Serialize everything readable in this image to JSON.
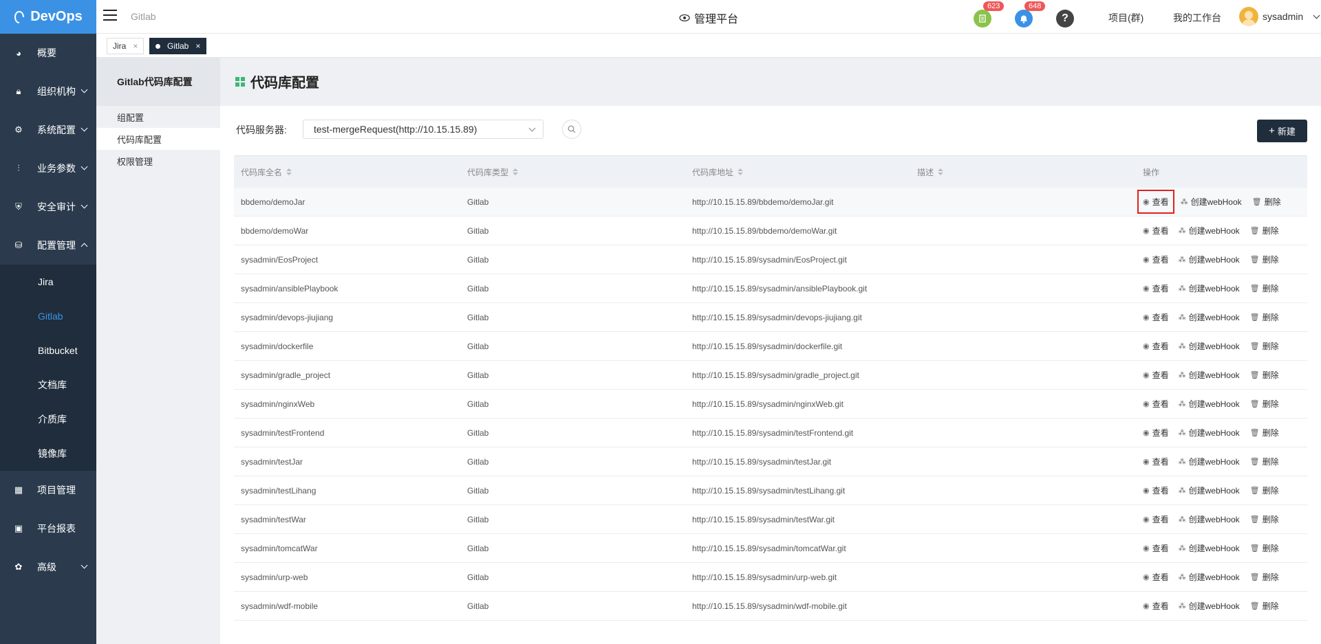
{
  "app": {
    "logo": "DevOps",
    "crumb": "Gitlab",
    "platform_title": "管理平台"
  },
  "header": {
    "badge_doc": "623",
    "badge_bell": "648",
    "link_projects": "项目(群)",
    "link_workbench": "我的工作台",
    "username": "sysadmin",
    "colors": {
      "doc": "#8bc34a",
      "bell": "#3b92e5",
      "help": "#444444",
      "badge": "#f05656"
    }
  },
  "sidebar": {
    "items": [
      {
        "label": "概要",
        "icon": "dashboard-icon"
      },
      {
        "label": "组织机构",
        "icon": "lock-icon"
      },
      {
        "label": "系统配置",
        "icon": "gear-icon"
      },
      {
        "label": "业务参数",
        "icon": "sliders-icon"
      },
      {
        "label": "安全审计",
        "icon": "shield-icon"
      },
      {
        "label": "配置管理",
        "icon": "database-icon"
      }
    ],
    "sub_items": [
      "Jira",
      "Gitlab",
      "Bitbucket",
      "文档库",
      "介质库",
      "镜像库"
    ],
    "bottom_items": [
      {
        "label": "项目管理",
        "icon": "grid-icon"
      },
      {
        "label": "平台报表",
        "icon": "monitor-icon"
      },
      {
        "label": "高级",
        "icon": "palette-icon"
      }
    ]
  },
  "tabs": [
    {
      "label": "Jira"
    },
    {
      "label": "Gitlab"
    }
  ],
  "subside": {
    "title": "Gitlab代码库配置",
    "items": [
      "组配置",
      "代码库配置",
      "权限管理"
    ]
  },
  "main": {
    "title": "代码库配置",
    "server_label": "代码服务器:",
    "server_value": "test-mergeRequest(http://10.15.15.89)",
    "new_label": "新建"
  },
  "table": {
    "headers": [
      "代码库全名",
      "代码库类型",
      "代码库地址",
      "描述",
      "操作"
    ],
    "actions": {
      "view": "查看",
      "hook": "创建webHook",
      "delete": "删除"
    },
    "rows": [
      {
        "name": "bbdemo/demoJar",
        "type": "Gitlab",
        "url": "http://10.15.15.89/bbdemo/demoJar.git",
        "desc": ""
      },
      {
        "name": "bbdemo/demoWar",
        "type": "Gitlab",
        "url": "http://10.15.15.89/bbdemo/demoWar.git",
        "desc": ""
      },
      {
        "name": "sysadmin/EosProject",
        "type": "Gitlab",
        "url": "http://10.15.15.89/sysadmin/EosProject.git",
        "desc": ""
      },
      {
        "name": "sysadmin/ansiblePlaybook",
        "type": "Gitlab",
        "url": "http://10.15.15.89/sysadmin/ansiblePlaybook.git",
        "desc": ""
      },
      {
        "name": "sysadmin/devops-jiujiang",
        "type": "Gitlab",
        "url": "http://10.15.15.89/sysadmin/devops-jiujiang.git",
        "desc": ""
      },
      {
        "name": "sysadmin/dockerfile",
        "type": "Gitlab",
        "url": "http://10.15.15.89/sysadmin/dockerfile.git",
        "desc": ""
      },
      {
        "name": "sysadmin/gradle_project",
        "type": "Gitlab",
        "url": "http://10.15.15.89/sysadmin/gradle_project.git",
        "desc": ""
      },
      {
        "name": "sysadmin/nginxWeb",
        "type": "Gitlab",
        "url": "http://10.15.15.89/sysadmin/nginxWeb.git",
        "desc": ""
      },
      {
        "name": "sysadmin/testFrontend",
        "type": "Gitlab",
        "url": "http://10.15.15.89/sysadmin/testFrontend.git",
        "desc": ""
      },
      {
        "name": "sysadmin/testJar",
        "type": "Gitlab",
        "url": "http://10.15.15.89/sysadmin/testJar.git",
        "desc": ""
      },
      {
        "name": "sysadmin/testLihang",
        "type": "Gitlab",
        "url": "http://10.15.15.89/sysadmin/testLihang.git",
        "desc": ""
      },
      {
        "name": "sysadmin/testWar",
        "type": "Gitlab",
        "url": "http://10.15.15.89/sysadmin/testWar.git",
        "desc": ""
      },
      {
        "name": "sysadmin/tomcatWar",
        "type": "Gitlab",
        "url": "http://10.15.15.89/sysadmin/tomcatWar.git",
        "desc": ""
      },
      {
        "name": "sysadmin/urp-web",
        "type": "Gitlab",
        "url": "http://10.15.15.89/sysadmin/urp-web.git",
        "desc": ""
      },
      {
        "name": "sysadmin/wdf-mobile",
        "type": "Gitlab",
        "url": "http://10.15.15.89/sysadmin/wdf-mobile.git",
        "desc": ""
      }
    ]
  }
}
